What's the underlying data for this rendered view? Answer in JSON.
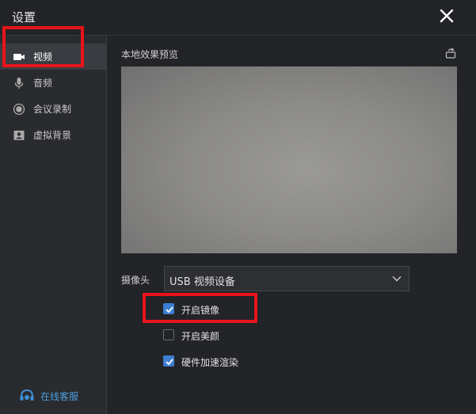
{
  "window": {
    "title": "设置"
  },
  "sidebar": {
    "items": [
      {
        "label": "视频",
        "icon": "video-camera-icon",
        "active": true
      },
      {
        "label": "音频",
        "icon": "microphone-icon",
        "active": false
      },
      {
        "label": "会议录制",
        "icon": "record-icon",
        "active": false
      },
      {
        "label": "虚拟背景",
        "icon": "portrait-icon",
        "active": false
      }
    ],
    "support_label": "在线客服"
  },
  "video": {
    "preview_title": "本地效果预览",
    "camera_label": "摄像头",
    "camera_value": "USB 视频设备",
    "options": [
      {
        "label": "开启镜像",
        "checked": true
      },
      {
        "label": "开启美颜",
        "checked": false
      },
      {
        "label": "硬件加速渲染",
        "checked": true
      }
    ]
  },
  "colors": {
    "accent": "#3c7fd1",
    "support_link": "#4a9fe0",
    "annotation": "#e8141a"
  }
}
